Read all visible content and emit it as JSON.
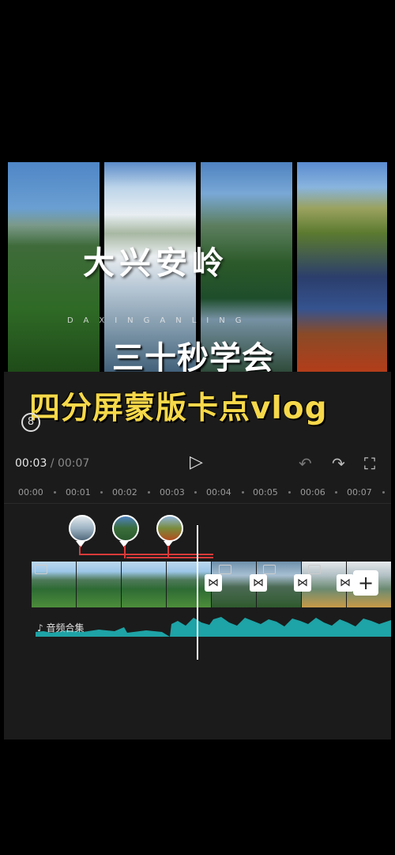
{
  "preview": {
    "title_cn": "大兴安岭",
    "subtitle_en": "DAXINGANLING",
    "overlay_line1": "三十秒学会",
    "overlay_line2": "四分屏蒙版卡点vlog"
  },
  "badge": "8",
  "player": {
    "current_time": "00:03",
    "separator": " / ",
    "total_time": "00:07",
    "play_icon": "▷",
    "undo_icon": "↶",
    "redo_icon": "↷",
    "fullscreen_icon": "⛶"
  },
  "ruler": [
    "00:00",
    "00:01",
    "00:02",
    "00:03",
    "00:04",
    "00:05",
    "00:06",
    "00:07"
  ],
  "audio": {
    "label": "音频合集",
    "note_icon": "♪"
  },
  "transition_icon": "⋈",
  "add_icon": "+",
  "colors": {
    "accent_yellow": "#f6d84a",
    "waveform": "#1ea3a6",
    "marker_line": "#d93a3a"
  }
}
